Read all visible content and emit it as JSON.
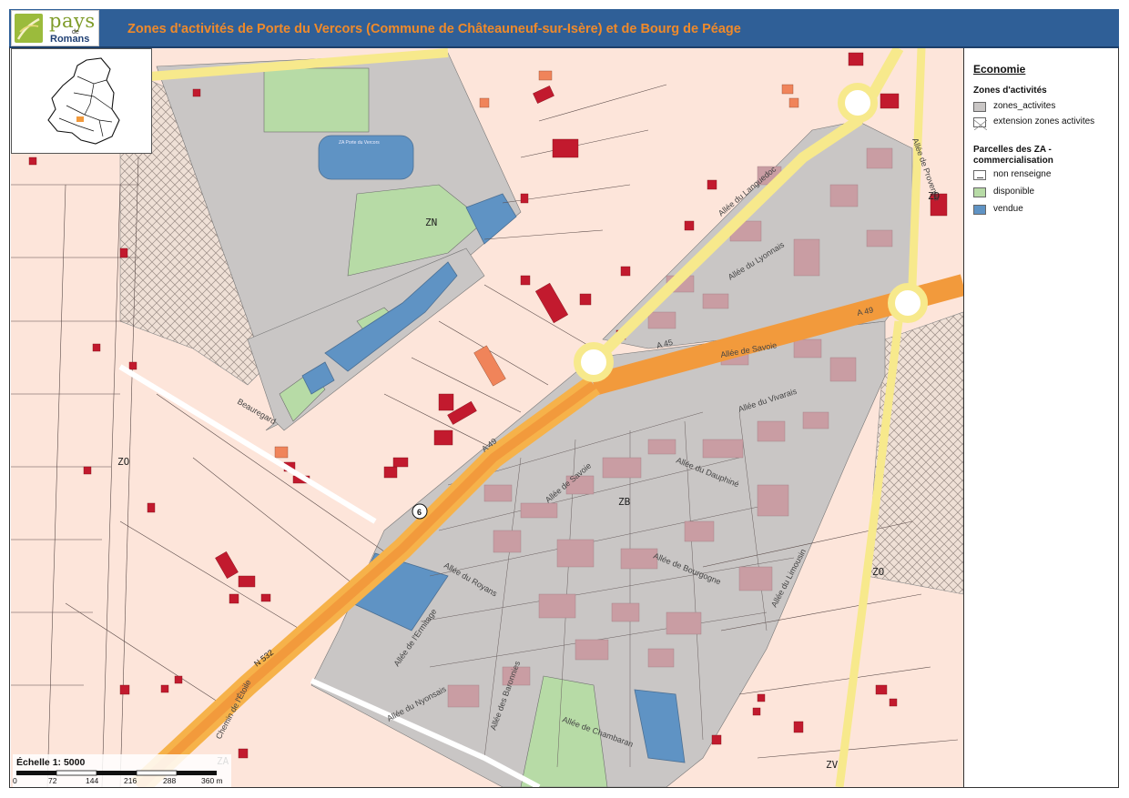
{
  "header": {
    "title": "Zones d'activités de Porte du Vercors (Commune de Châteauneuf-sur-Isère) et de Bourg de Péage",
    "logo": {
      "pays": "pays",
      "de": "de",
      "romans": "Romans"
    }
  },
  "colors": {
    "header_bg": "#2f5f97",
    "title": "#f08a2a",
    "map_bg": "#fde5da",
    "zones_activites": "#c9c6c5",
    "disponible": "#b7dba6",
    "vendue": "#5f93c4",
    "building": "#c21a2e",
    "building_grey": "#c99da3",
    "motorway": "#f29a3c",
    "main_road": "#f7e98c"
  },
  "map": {
    "zone_labels": [
      "ZN",
      "ZO",
      "ZB",
      "ZO",
      "ZD",
      "ZA",
      "ZV"
    ],
    "road_labels": [
      "A 49",
      "A 45",
      "A 49",
      "N 532",
      "Allée de Savoie",
      "Allée du Vivarais",
      "Allée du Dauphiné",
      "Allée de Bourgogne",
      "Allée du Royans",
      "Allée du Nyonsais",
      "Allée de Chambaran",
      "Allée des Baronnies",
      "Allée de l'Ermitage",
      "Allée du Languedoc",
      "Allée du Lyonnais",
      "Allée de Provence",
      "Allée du Limousin",
      "Allée de Savoie",
      "Beauregard",
      "Chemin de l'Étoile"
    ],
    "pond_label": "ZA Porte du Vercors",
    "route_shield": "6"
  },
  "legend": {
    "title": "Economie",
    "section1": "Zones d'activités",
    "items1": [
      {
        "label": "zones_activites",
        "swatch": "#c9c6c5",
        "pattern": "solid"
      },
      {
        "label": "extension zones activites",
        "swatch": "#ffffff",
        "pattern": "crosshatch"
      }
    ],
    "section2": "Parcelles des ZA - commercialisation",
    "items2": [
      {
        "label": "non renseigne",
        "swatch": "#ffffff",
        "pattern": "dash"
      },
      {
        "label": "disponible",
        "swatch": "#b7dba6",
        "pattern": "solid"
      },
      {
        "label": "vendue",
        "swatch": "#5f93c4",
        "pattern": "solid"
      }
    ]
  },
  "scale": {
    "label": "Échelle 1: 5000",
    "ticks": [
      "0",
      "72",
      "144",
      "216",
      "288",
      "360 m"
    ]
  }
}
